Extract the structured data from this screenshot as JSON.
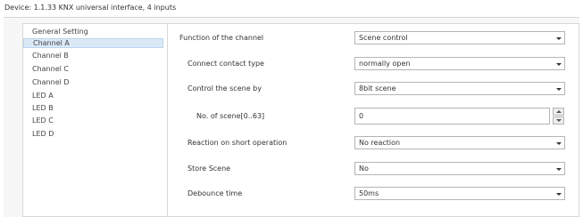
{
  "window": {
    "title": "Device: 1.1.33  KNX universal interface, 4 inputs"
  },
  "sidebar": {
    "items": [
      {
        "label": "General Setting",
        "selected": false
      },
      {
        "label": "Channel A",
        "selected": true
      },
      {
        "label": "Channel B",
        "selected": false
      },
      {
        "label": "Channel C",
        "selected": false
      },
      {
        "label": "Channel D",
        "selected": false
      },
      {
        "label": "LED A",
        "selected": false
      },
      {
        "label": "LED B",
        "selected": false
      },
      {
        "label": "LED C",
        "selected": false
      },
      {
        "label": "LED D",
        "selected": false
      }
    ]
  },
  "params": {
    "function": {
      "label": "Function of the channel",
      "value": "Scene control"
    },
    "contact_type": {
      "label": "Connect contact type",
      "value": "normally open"
    },
    "control_scene": {
      "label": "Control the scene by",
      "value": "8bit scene"
    },
    "scene_no": {
      "label": "No. of scene[0..63]",
      "value": "0"
    },
    "reaction": {
      "label": "Reaction on short operation",
      "value": "No reaction"
    },
    "store_scene": {
      "label": "Store Scene",
      "value": "No"
    },
    "debounce": {
      "label": "Debounce time",
      "value": "50ms"
    }
  },
  "colors": {
    "selection": "#dbe9f7",
    "border": "#b5b5b5",
    "background": "#f7f7f7"
  }
}
